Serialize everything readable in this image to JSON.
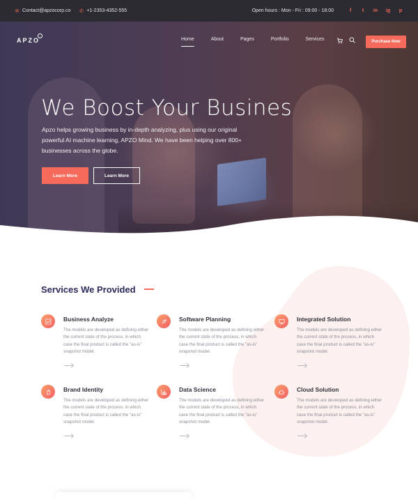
{
  "topbar": {
    "email": "Contact@apzocorp.co",
    "phone": "+1-2353-4352-555",
    "hours": "Open hours : Mon - Fri : 09:00 - 18:00",
    "social": [
      "f",
      "t",
      "in",
      "ig",
      "p"
    ]
  },
  "nav": {
    "logo": "APZO",
    "items": [
      "Home",
      "About",
      "Pages",
      "Portfolio",
      "Services"
    ],
    "cta": "Purchase Now"
  },
  "hero": {
    "title": "We Boost Your Busines",
    "description": "Apzo helps growing business by in-depth analyzing, plus using our original powerful AI machine learning, APZO Mind. We have been helping over 800+ businesses across the globe.",
    "button_primary": "Learn More",
    "button_secondary": "Learn More"
  },
  "services": {
    "title": "Services We Provided",
    "items": [
      {
        "name": "Business Analyze",
        "text": "The models are developed as defining either the current state of the process, in which case the final product is called the \"as-is\" snapshot model.",
        "icon": "chart-icon"
      },
      {
        "name": "Software Planning",
        "text": "The models are developed as defining either the current state of the process, in which case the final product is called the \"as-is\" snapshot model.",
        "icon": "rocket-icon"
      },
      {
        "name": "Integrated Solution",
        "text": "The models are developed as defining either the current state of the process, in which case the final product is called the \"as-is\" snapshot model.",
        "icon": "monitor-icon"
      },
      {
        "name": "Brand Identity",
        "text": "The models are developed as defining either the current state of the process, in which case the final product is called the \"as-is\" snapshot model.",
        "icon": "hand-icon"
      },
      {
        "name": "Data Science",
        "text": "The models are developed as defining either the current state of the process, in which case the final product is called the \"as-is\" snapshot model.",
        "icon": "bar-chart-icon"
      },
      {
        "name": "Cloud Solution",
        "text": "The models are developed as defining either the current state of the process, in which case the final product is called the \"as-is\" snapshot model.",
        "icon": "cloud-icon"
      }
    ]
  },
  "colors": {
    "accent": "#f56a5b",
    "topbar": "#2b2b31",
    "heading": "#2c2a5c"
  }
}
